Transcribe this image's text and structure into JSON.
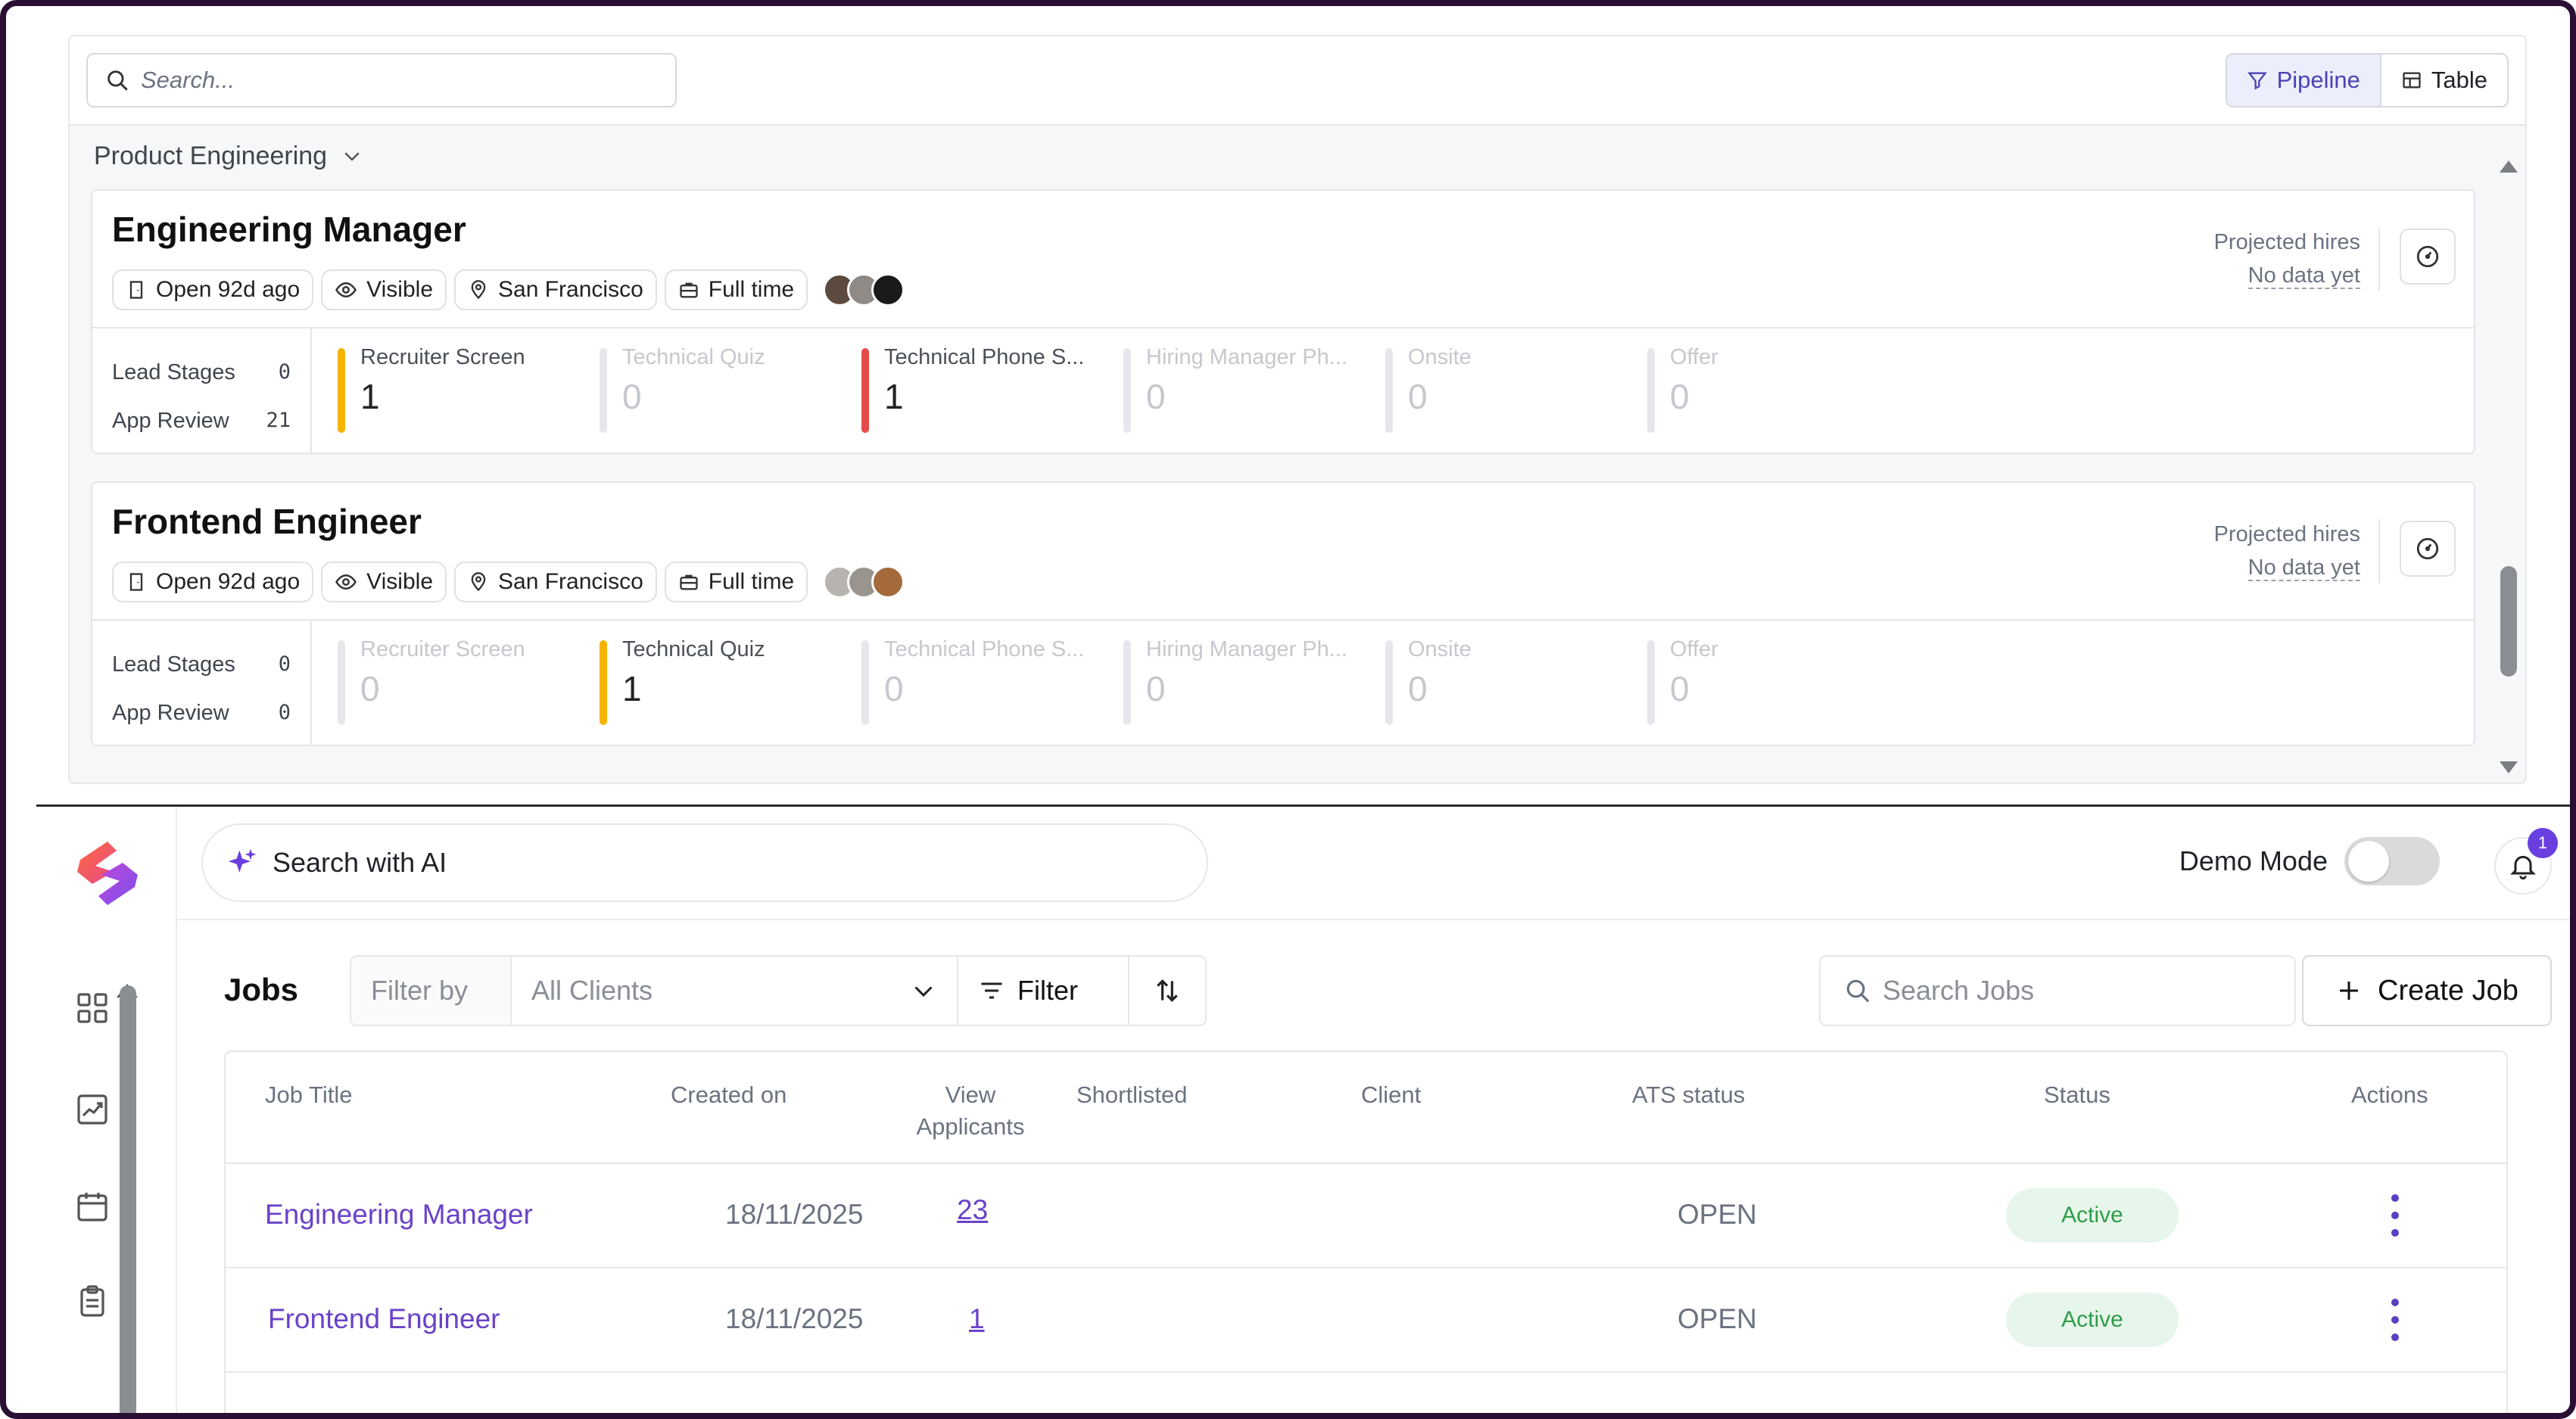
{
  "ats": {
    "search_placeholder": "Search...",
    "views": {
      "pipeline": "Pipeline",
      "table": "Table"
    },
    "group": "Product Engineering",
    "jobs": [
      {
        "title": "Engineering Manager",
        "chips": {
          "open": "Open 92d ago",
          "visibility": "Visible",
          "location": "San Francisco",
          "type": "Full time"
        },
        "projected_label": "Projected hires",
        "projected_value": "No data yet",
        "lead_stages_label": "Lead Stages",
        "lead_stages": "0",
        "app_review_label": "App Review",
        "app_review": "21",
        "stages": [
          {
            "name": "Recruiter Screen",
            "count": "1"
          },
          {
            "name": "Technical Quiz",
            "count": "0"
          },
          {
            "name": "Technical Phone S...",
            "count": "1"
          },
          {
            "name": "Hiring Manager Ph...",
            "count": "0"
          },
          {
            "name": "Onsite",
            "count": "0"
          },
          {
            "name": "Offer",
            "count": "0"
          }
        ]
      },
      {
        "title": "Frontend Engineer",
        "chips": {
          "open": "Open 92d ago",
          "visibility": "Visible",
          "location": "San Francisco",
          "type": "Full time"
        },
        "projected_label": "Projected hires",
        "projected_value": "No data yet",
        "lead_stages_label": "Lead Stages",
        "lead_stages": "0",
        "app_review_label": "App Review",
        "app_review": "0",
        "stages": [
          {
            "name": "Recruiter Screen",
            "count": "0"
          },
          {
            "name": "Technical Quiz",
            "count": "1"
          },
          {
            "name": "Technical Phone S...",
            "count": "0"
          },
          {
            "name": "Hiring Manager Ph...",
            "count": "0"
          },
          {
            "name": "Onsite",
            "count": "0"
          },
          {
            "name": "Offer",
            "count": "0"
          }
        ]
      }
    ]
  },
  "app": {
    "ai_search": "Search with AI",
    "demo_mode": "Demo Mode",
    "notification_count": "1",
    "jobs_title": "Jobs",
    "filter_by": "Filter by",
    "client_select": "All Clients",
    "filter_label": "Filter",
    "search_jobs_placeholder": "Search Jobs",
    "create_job": "Create Job",
    "columns": {
      "job_title": "Job Title",
      "created_on": "Created on",
      "view": "View",
      "applicants": "Applicants",
      "shortlisted": "Shortlisted",
      "client": "Client",
      "ats_status": "ATS status",
      "status": "Status",
      "actions": "Actions"
    },
    "rows": [
      {
        "title": "Engineering Manager",
        "created": "18/11/2025",
        "applicants": "23",
        "ats": "OPEN",
        "status": "Active"
      },
      {
        "title": "Frontend Engineer",
        "created": "18/11/2025",
        "applicants": "1",
        "ats": "OPEN",
        "status": "Active"
      }
    ]
  },
  "colors": {
    "accent": "#6a42c8",
    "stage_active_yellow": "#f4b400",
    "stage_active_red": "#e74a4a",
    "status_active_bg": "#e7f6ea",
    "status_active_text": "#2f9d4b"
  }
}
